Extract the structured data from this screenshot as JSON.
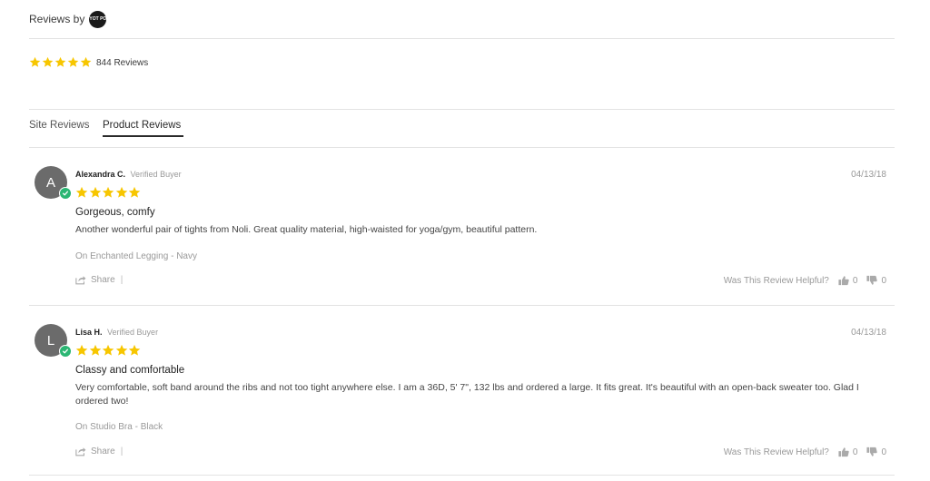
{
  "header": {
    "reviews_by": "Reviews by",
    "logo_text": "YOT PO",
    "logo_icon": "yotpo-logo"
  },
  "summary": {
    "rating": 5,
    "count_text": "844 Reviews",
    "star_color": "#f7c600"
  },
  "tabs": [
    {
      "label": "Site Reviews",
      "active": false
    },
    {
      "label": "Product Reviews",
      "active": true
    }
  ],
  "reviews": [
    {
      "avatar_letter": "A",
      "name": "Alexandra C.",
      "verified": "Verified Buyer",
      "date": "04/13/18",
      "rating": 5,
      "title": "Gorgeous, comfy",
      "body": "Another wonderful pair of tights from Noli. Great quality material, high-waisted for yoga/gym, beautiful pattern.",
      "product": "On Enchanted Legging - Navy",
      "share_label": "Share",
      "share_sep": "|",
      "helpful_label": "Was This Review Helpful?",
      "up_votes": "0",
      "down_votes": "0"
    },
    {
      "avatar_letter": "L",
      "name": "Lisa H.",
      "verified": "Verified Buyer",
      "date": "04/13/18",
      "rating": 5,
      "title": "Classy and comfortable",
      "body": "Very comfortable, soft band around the ribs and not too tight anywhere else. I am a 36D, 5' 7\", 132 lbs and ordered a large. It fits great. It's beautiful with an open-back sweater too. Glad I ordered two!",
      "product": "On Studio Bra - Black",
      "share_label": "Share",
      "share_sep": "|",
      "helpful_label": "Was This Review Helpful?",
      "up_votes": "0",
      "down_votes": "0"
    }
  ],
  "colors": {
    "star": "#f7c600",
    "verified_badge": "#2bb673",
    "avatar_bg": "#6b6b6b",
    "divider": "#e3e3e3"
  }
}
